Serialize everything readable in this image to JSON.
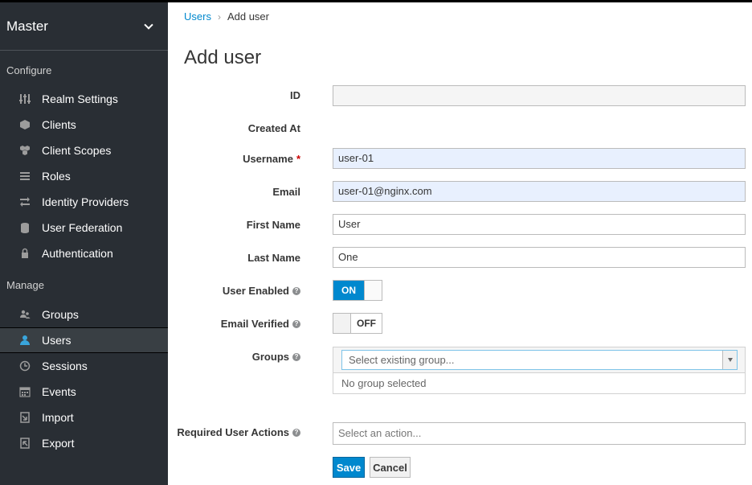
{
  "sidebar": {
    "realm": "Master",
    "configure_title": "Configure",
    "configure_items": [
      {
        "label": "Realm Settings",
        "icon": "sliders-icon"
      },
      {
        "label": "Clients",
        "icon": "cube-icon"
      },
      {
        "label": "Client Scopes",
        "icon": "cubes-icon"
      },
      {
        "label": "Roles",
        "icon": "list-icon"
      },
      {
        "label": "Identity Providers",
        "icon": "exchange-icon"
      },
      {
        "label": "User Federation",
        "icon": "database-icon"
      },
      {
        "label": "Authentication",
        "icon": "lock-icon"
      }
    ],
    "manage_title": "Manage",
    "manage_items": [
      {
        "label": "Groups",
        "icon": "users-icon"
      },
      {
        "label": "Users",
        "icon": "user-icon",
        "active": true
      },
      {
        "label": "Sessions",
        "icon": "clock-icon"
      },
      {
        "label": "Events",
        "icon": "calendar-icon"
      },
      {
        "label": "Import",
        "icon": "import-icon"
      },
      {
        "label": "Export",
        "icon": "export-icon"
      }
    ]
  },
  "breadcrumb": {
    "parent": "Users",
    "separator": "›",
    "current": "Add user"
  },
  "page": {
    "title": "Add user"
  },
  "form": {
    "id_label": "ID",
    "id_value": "",
    "created_at_label": "Created At",
    "username_label": "Username",
    "username_required": "*",
    "username_value": "user-01",
    "email_label": "Email",
    "email_value": "user-01@nginx.com",
    "first_name_label": "First Name",
    "first_name_value": "User",
    "last_name_label": "Last Name",
    "last_name_value": "One",
    "user_enabled_label": "User Enabled",
    "user_enabled_state": "ON",
    "email_verified_label": "Email Verified",
    "email_verified_state": "OFF",
    "groups_label": "Groups",
    "groups_placeholder": "Select existing group...",
    "groups_empty": "No group selected",
    "required_actions_label": "Required User Actions",
    "required_actions_placeholder": "Select an action...",
    "help_glyph": "?",
    "save_label": "Save",
    "cancel_label": "Cancel"
  },
  "colors": {
    "sidebar_bg": "#292e34",
    "accent": "#0088ce",
    "autofill_bg": "#e8f0fe"
  }
}
